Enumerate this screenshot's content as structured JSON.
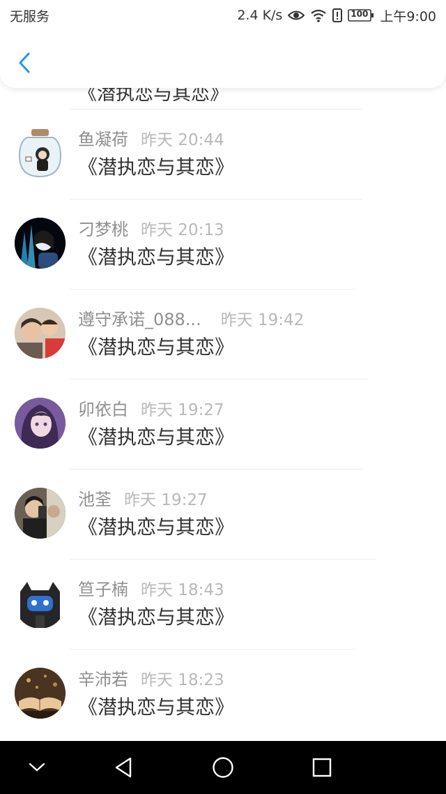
{
  "status_bar": {
    "carrier": "无服务",
    "speed": "2.4 K/s",
    "battery": "100",
    "time": "上午9:00",
    "icons": [
      "eye-icon",
      "wifi-icon",
      "alert-icon",
      "battery-icon"
    ]
  },
  "header": {
    "back_icon": "chevron-left-icon"
  },
  "list": {
    "partial_comment": "《潜执恋与其恋》",
    "items": [
      {
        "name": "鱼凝荷",
        "time": "昨天 20:44",
        "comment": "《潜执恋与其恋》"
      },
      {
        "name": "刁梦桃",
        "time": "昨天 20:13",
        "comment": "《潜执恋与其恋》"
      },
      {
        "name": "遵守承诺_088...",
        "time": "昨天 19:42",
        "comment": "《潜执恋与其恋》"
      },
      {
        "name": "卯依白",
        "time": "昨天 19:27",
        "comment": "《潜执恋与其恋》"
      },
      {
        "name": "池荃",
        "time": "昨天 19:27",
        "comment": "《潜执恋与其恋》"
      },
      {
        "name": "笪子楠",
        "time": "昨天 18:43",
        "comment": "《潜执恋与其恋》"
      },
      {
        "name": "辛沛若",
        "time": "昨天 18:23",
        "comment": "《潜执恋与其恋》"
      }
    ]
  },
  "nav_bar": {
    "icons": [
      "collapse-icon",
      "back-triangle-icon",
      "home-circle-icon",
      "recents-square-icon"
    ]
  },
  "colors": {
    "accent": "#2196F3",
    "name": "#8f8f8f",
    "time": "#b9b9b9",
    "text": "#333333"
  }
}
